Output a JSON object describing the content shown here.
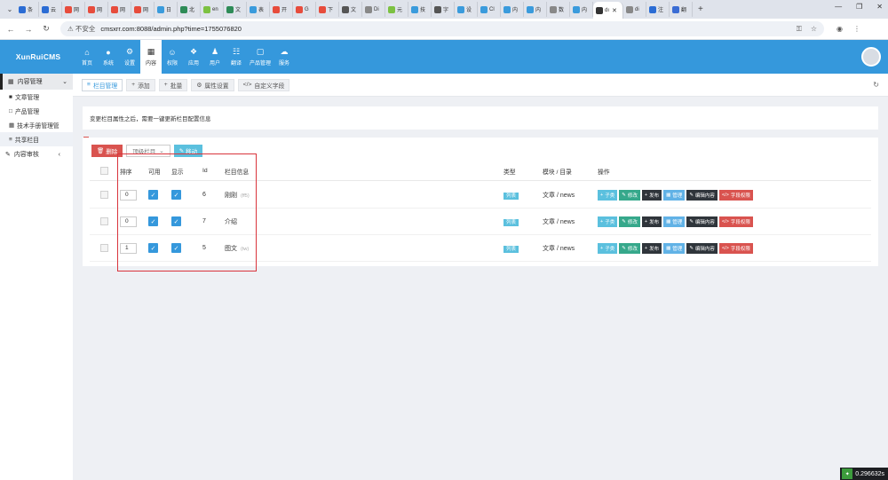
{
  "browser": {
    "tabs": [
      {
        "label": "条",
        "color": "#2b6cd4"
      },
      {
        "label": "云",
        "color": "#2b6cd4"
      },
      {
        "label": "网",
        "color": "#e74c3c"
      },
      {
        "label": "网",
        "color": "#e74c3c"
      },
      {
        "label": "网",
        "color": "#e74c3c"
      },
      {
        "label": "网",
        "color": "#e74c3c"
      },
      {
        "label": "日",
        "color": "#3a9bdc"
      },
      {
        "label": "北",
        "color": "#2e8b57"
      },
      {
        "label": "en",
        "color": "#7cc142"
      },
      {
        "label": "文",
        "color": "#2e8b57"
      },
      {
        "label": "表",
        "color": "#3a9bdc"
      },
      {
        "label": "开",
        "color": "#e74c3c"
      },
      {
        "label": "G",
        "color": "#e74c3c"
      },
      {
        "label": "下",
        "color": "#e74c3c"
      },
      {
        "label": "文",
        "color": "#555555"
      },
      {
        "label": "Di",
        "color": "#888888"
      },
      {
        "label": "元",
        "color": "#7cc142"
      },
      {
        "label": "技",
        "color": "#3a9bdc"
      },
      {
        "label": "字",
        "color": "#555555"
      },
      {
        "label": "设",
        "color": "#3a9bdc"
      },
      {
        "label": "Cl",
        "color": "#3a9bdc"
      },
      {
        "label": "内",
        "color": "#3a9bdc"
      },
      {
        "label": "内",
        "color": "#3a9bdc"
      },
      {
        "label": "数",
        "color": "#888888"
      },
      {
        "label": "内",
        "color": "#3a9bdc"
      },
      {
        "label": "dı",
        "color": "#333333",
        "active": true
      },
      {
        "label": "di",
        "color": "#888888"
      },
      {
        "label": "注",
        "color": "#2b6cd4"
      },
      {
        "label": "翻",
        "color": "#3a6cd4"
      }
    ],
    "active_tab_label": "dı",
    "not_secure": "不安全",
    "url": "cmsxrr.com:8088/admin.php?time=1755076820"
  },
  "header": {
    "logo_text": "XunRuiCMS",
    "nav": [
      {
        "label": "首页",
        "icon": "home-icon",
        "glyph": "⌂"
      },
      {
        "label": "系统",
        "icon": "globe-icon",
        "glyph": "●"
      },
      {
        "label": "设置",
        "icon": "gear-icon",
        "glyph": "⚙"
      },
      {
        "label": "内容",
        "icon": "grid-icon",
        "glyph": "▦",
        "active": true
      },
      {
        "label": "权限",
        "icon": "user-circle-icon",
        "glyph": "☺"
      },
      {
        "label": "应用",
        "icon": "puzzle-icon",
        "glyph": "❖"
      },
      {
        "label": "用户",
        "icon": "user-icon",
        "glyph": "♟"
      },
      {
        "label": "翻译",
        "icon": "translate-icon",
        "glyph": "☷"
      },
      {
        "label": "产品管理",
        "icon": "bag-icon",
        "glyph": "▢"
      },
      {
        "label": "服务",
        "icon": "cloud-icon",
        "glyph": "☁"
      }
    ]
  },
  "sidebar": {
    "group_content": "内容管理",
    "items": [
      {
        "label": "文章管理",
        "glyph": "■"
      },
      {
        "label": "产品管理",
        "glyph": "□"
      },
      {
        "label": "技术手册管理管",
        "glyph": "▦"
      },
      {
        "label": "共享栏目",
        "glyph": "≡"
      }
    ],
    "group_review": "内容审核"
  },
  "toolbar": {
    "buttons": [
      {
        "label": "栏目管理",
        "glyph": "≡",
        "active": true
      },
      {
        "label": "添加",
        "glyph": "+"
      },
      {
        "label": "批量",
        "glyph": "+"
      },
      {
        "label": "属性设置",
        "glyph": "⚙"
      },
      {
        "label": "自定义字段",
        "glyph": "</>"
      }
    ]
  },
  "notice": "变更栏目属性之后，需要一键更新栏目配置信息",
  "actions": {
    "delete": "删除",
    "select_placeholder": "顶级栏目",
    "move": "移动"
  },
  "table": {
    "headers": {
      "sort": "排序",
      "enabled": "可用",
      "visible": "显示",
      "id": "Id",
      "info": "栏目信息",
      "type": "类型",
      "module": "模块 / 目录",
      "ops": "操作"
    },
    "rows": [
      {
        "sort": "0",
        "id": "6",
        "name": "刚刚",
        "dir": "(ff5)",
        "type": "列表",
        "module": "文章 / news"
      },
      {
        "sort": "0",
        "id": "7",
        "name": "介绍",
        "dir": "",
        "type": "列表",
        "module": "文章 / news"
      },
      {
        "sort": "1",
        "id": "5",
        "name": "图文",
        "dir": "(tw)",
        "type": "列表",
        "module": "文章 / news"
      }
    ],
    "op_labels": [
      {
        "label": "子类",
        "glyph": "+",
        "cls": "blue"
      },
      {
        "label": "修改",
        "glyph": "✎",
        "cls": "green"
      },
      {
        "label": "发布",
        "glyph": "+",
        "cls": "dark"
      },
      {
        "label": "管理",
        "glyph": "▦",
        "cls": "lblue"
      },
      {
        "label": "编辑内容",
        "glyph": "✎",
        "cls": "dark"
      },
      {
        "label": "字段权限",
        "glyph": "</>",
        "cls": "red"
      }
    ]
  },
  "timer": "0.296632s"
}
